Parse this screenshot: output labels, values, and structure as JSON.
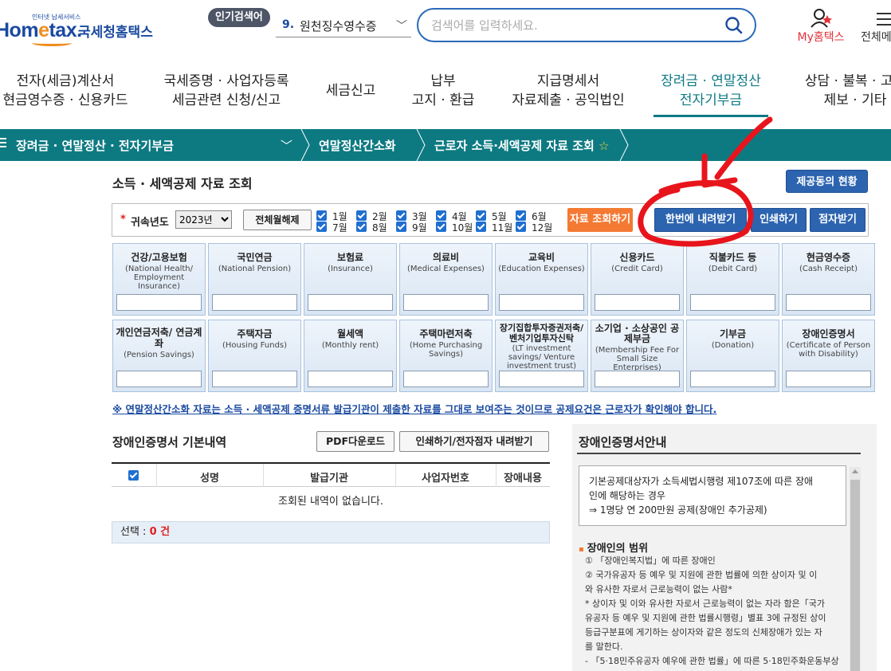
{
  "header": {
    "logo_small": "인터넷 납세서비스",
    "logo_main_a": "Hom",
    "logo_main_e": "e",
    "logo_main_b": "tax.",
    "logo_korean": "국세청홈택스",
    "popular_badge": "인기검색어",
    "popular_rank": "9.",
    "popular_term": "원천징수영수증",
    "search_placeholder": "검색어를 입력하세요.",
    "my_label_a": "My",
    "my_label_b": "홈택스",
    "all_menu_label": "전체메"
  },
  "gnb": [
    {
      "line1": "전자(세금)계산서",
      "line2": "현금영수증 · 신용카드"
    },
    {
      "line1": "국세증명 · 사업자등록",
      "line2": "세금관련 신청/신고"
    },
    {
      "line1": "세금신고",
      "line2": ""
    },
    {
      "line1": "납부",
      "line2": "고지 · 환급"
    },
    {
      "line1": "지급명세서",
      "line2": "자료제출 · 공익법인"
    },
    {
      "line1": "장려금 · 연말정산",
      "line2": "전자기부금"
    },
    {
      "line1": "상담 · 불복 · 고충",
      "line2": "제보 · 기타"
    }
  ],
  "breadcrumb": {
    "level1": "장려금 · 연말정산 · 전자기부금",
    "level2": "연말정산간소화",
    "level3": "근로자 소득·세액공제 자료 조회",
    "star": "☆"
  },
  "page": {
    "title": "소득 · 세액공제 자료 조회",
    "provider_button": "제공동의 현황"
  },
  "filter": {
    "required_mark": "*",
    "year_label": "귀속년도",
    "year_value": "2023년",
    "unselect_all": "전체월해제",
    "months": [
      "1월",
      "2월",
      "3월",
      "4월",
      "5월",
      "6월",
      "7월",
      "8월",
      "9월",
      "10월",
      "11월",
      "12월"
    ],
    "months_checked": true,
    "search_button": "자료 조회하기",
    "download_all_button": "한번에 내려받기",
    "print_button": "인쇄하기",
    "braille_button": "점자받기"
  },
  "categories": [
    {
      "ko": "건강/고용보험",
      "en": "(National Health/ Employment Insurance)"
    },
    {
      "ko": "국민연금",
      "en": "(National Pension)"
    },
    {
      "ko": "보험료",
      "en": "(Insurance)"
    },
    {
      "ko": "의료비",
      "en": "(Medical Expenses)"
    },
    {
      "ko": "교육비",
      "en": "(Education Expenses)"
    },
    {
      "ko": "신용카드",
      "en": "(Credit Card)"
    },
    {
      "ko": "직불카드 등",
      "en": "(Debit Card)"
    },
    {
      "ko": "현금영수증",
      "en": "(Cash Receipt)"
    },
    {
      "ko": "개인연금저축/ 연금계좌",
      "en": "(Pension Savings)"
    },
    {
      "ko": "주택자금",
      "en": "(Housing Funds)"
    },
    {
      "ko": "월세액",
      "en": "(Monthly rent)"
    },
    {
      "ko": "주택마련저축",
      "en": "(Home Purchasing Savings)"
    },
    {
      "ko": "장기집합투자증권저축/ 벤처기업투자신탁",
      "en": "(LT investment savings/ Venture investment trust)"
    },
    {
      "ko": "소기업 · 소상공인 공제부금",
      "en": "(Membership Fee For Small Size Enterprises)"
    },
    {
      "ko": "기부금",
      "en": "(Donation)"
    },
    {
      "ko": "장애인증명서",
      "en": "(Certificate of Person with Disability)"
    }
  ],
  "notice": "※ 연말정산간소화 자료는 소득 · 세액공제 증명서류 발급기관이 제출한 자료를 그대로 보여주는 것이므로 공제요건은 근로자가 확인해야 합니다.",
  "disability": {
    "section_title": "장애인증명서 기본내역",
    "pdf_button": "PDF다운로드",
    "print_button": "인쇄하기/전자점자 내려받기",
    "columns": [
      "성명",
      "발급기관",
      "사업자번호",
      "장애내용"
    ],
    "empty_message": "조회된 내역이 없습니다.",
    "count_label": "선택 : ",
    "count_value": "0 건"
  },
  "info": {
    "title": "장애인증명서안내",
    "box_line1": "기본공제대상자가 소득세법시행령 제107조에 따른 장애",
    "box_line2": "인에 해당하는 경우",
    "box_line3": "⇒ 1명당 연 200만원 공제(장애인 추가공제)",
    "sub_title": "장애인의 범위",
    "body": [
      "① 「장애인복지법」에 따른 장애인",
      "② 국가유공자 등 예우 및 지원에 관한 법률에 의한 상이자 및 이",
      "와 유사한 자로서 근로능력이 없는 사람*",
      "* 상이자 및 이와 유사한 자로서 근로능력이 없는 자라 함은「국가",
      "유공자 등 예우 및 지원에 관한 법률시행령」별표 3에 규정된 상이",
      "등급구분표에 게기하는 상이자와 같은 정도의 신체장애가 있는 자",
      "를 말한다.",
      "- 「5·18민주유공자 예우에 관한 법률」에 따른 5·18민주화운동부상"
    ]
  },
  "colors": {
    "brand_blue": "#1a4aa0",
    "teal": "#0d7a82",
    "orange": "#f47a33",
    "button_blue": "#2c64b0",
    "annotation_red": "#e8141c"
  }
}
